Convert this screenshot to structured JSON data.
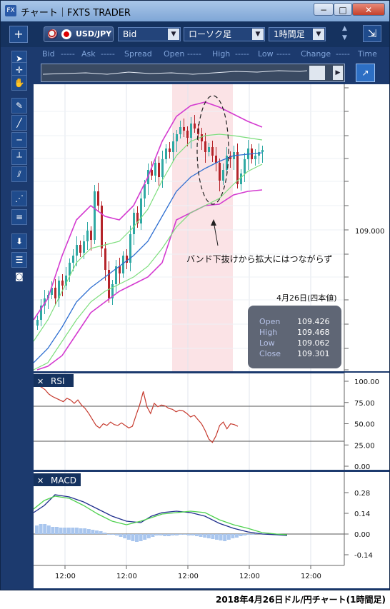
{
  "window": {
    "title": "チャート｜FXTS TRADER",
    "app_icon": "FX",
    "minimize": "−",
    "maximize": "□",
    "close": "✕"
  },
  "toolbar": {
    "add_label": "+",
    "pair": "USD/JPY",
    "price_type": "Bid",
    "chart_type": "ローソク足",
    "timeframe": "1時間足",
    "expand_label": "⇲"
  },
  "quote": {
    "bid_label": "Bid",
    "bid_value": "-----",
    "ask_label": "Ask",
    "ask_value": "-----",
    "spread_label": "Spread",
    "open_label": "Open",
    "open_value": "-----",
    "high_label": "High",
    "high_value": "-----",
    "low_label": "Low",
    "low_value": "-----",
    "change_label": "Change",
    "change_value": "-----",
    "time_label": "Time"
  },
  "tools": [
    "cursor-icon",
    "crosshair-icon",
    "hand-icon",
    "pencil-icon",
    "trendline-icon",
    "hline-icon",
    "vline-icon",
    "channel-icon",
    "fib-fan-icon",
    "fib-retracement-icon",
    "save-icon",
    "list-icon",
    "camera-icon"
  ],
  "colors": {
    "candle_up": "#2fa9a4",
    "candle_down": "#b5242a",
    "bb_outer": "#d43bd0",
    "bb_inner": "#7dde7d",
    "bb_mid": "#2f6fd1",
    "highlight": "#fbe3e6",
    "rsi_line": "#c63a2e",
    "macd_line": "#1f2e8c",
    "signal_line": "#4fd14f",
    "histogram": "#a9c6ee"
  },
  "main_chart": {
    "y_label": "109.000",
    "annotation": "バンド下抜けから拡大にはつながらず",
    "info_title": "4月26日(四本値)",
    "info": {
      "open_label": "Open",
      "open": "109.426",
      "high_label": "High",
      "high": "109.468",
      "low_label": "Low",
      "low": "109.062",
      "close_label": "Close",
      "close": "109.301"
    }
  },
  "rsi": {
    "label": "RSI",
    "close_label": "✕",
    "ticks": [
      "100.00",
      "75.00",
      "50.00",
      "25.00",
      "0.00"
    ],
    "values": [
      95,
      93,
      90,
      85,
      82,
      80,
      78,
      76,
      80,
      78,
      74,
      78,
      72,
      68,
      62,
      55,
      48,
      45,
      50,
      48,
      52,
      49,
      48,
      51,
      48,
      45,
      47,
      60,
      72,
      88,
      70,
      62,
      74,
      70,
      72,
      71,
      68,
      67,
      64,
      66,
      65,
      62,
      58,
      60,
      55,
      50,
      42,
      32,
      28,
      36,
      48,
      52,
      44,
      50,
      49,
      47
    ]
  },
  "macd": {
    "label": "MACD",
    "close_label": "✕",
    "ticks": [
      "0.28",
      "0.14",
      "0.00",
      "-0.14"
    ]
  },
  "x_axis": {
    "labels": [
      "12:00",
      "12:00",
      "12:00",
      "12:00",
      "12:00"
    ]
  },
  "caption": "2018年4月26日ドル/円チャート(1時間足)"
}
